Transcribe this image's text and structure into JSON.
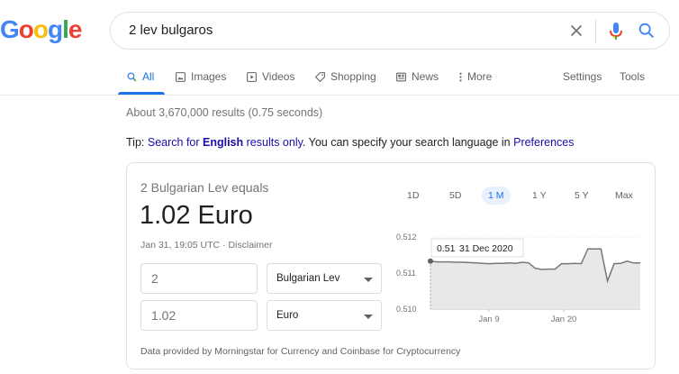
{
  "logo": {
    "letters": [
      "G",
      "o",
      "o",
      "g",
      "l",
      "e"
    ],
    "colors": [
      "#4285f4",
      "#ea4335",
      "#fbbc05",
      "#4285f4",
      "#34a853",
      "#ea4335"
    ]
  },
  "search": {
    "query": "2 lev bulgaros",
    "icons": [
      "close-icon",
      "microphone-icon",
      "search-icon"
    ]
  },
  "tabs": [
    {
      "label": "All",
      "icon": "search-icon",
      "active": true
    },
    {
      "label": "Images",
      "icon": "image-icon"
    },
    {
      "label": "Videos",
      "icon": "play-icon"
    },
    {
      "label": "Shopping",
      "icon": "tag-icon"
    },
    {
      "label": "News",
      "icon": "newspaper-icon"
    },
    {
      "label": "More",
      "icon": "more-vertical-icon"
    },
    {
      "label": "Settings"
    },
    {
      "label": "Tools"
    }
  ],
  "stats": "About 3,670,000 results (0.75 seconds)",
  "tip": {
    "prefix": "Tip: ",
    "link1": "Search for ",
    "bold": "English",
    "link2": " results only",
    "middle": ". You can specify your search language in ",
    "link3": "Preferences"
  },
  "converter": {
    "equals_label": "2 Bulgarian Lev equals",
    "result": "1.02 Euro",
    "meta": "Jan 31, 19:05 UTC · Disclaimer",
    "from_amount": "2",
    "from_currency": "Bulgarian Lev",
    "to_amount": "1.02",
    "to_currency": "Euro",
    "ranges": [
      "1D",
      "5D",
      "1 M",
      "1 Y",
      "5 Y",
      "Max"
    ],
    "active_range": "1 M",
    "footer": "Data provided by Morningstar for Currency and Coinbase for Cryptocurrency"
  },
  "chart_data": {
    "type": "area",
    "y_ticks": [
      "0.512",
      "0.511",
      "0.510"
    ],
    "ylim": [
      0.51,
      0.512
    ],
    "x_ticks": [
      "Jan 9",
      "Jan 20"
    ],
    "tooltip": {
      "value": "0.51",
      "date": "31 Dec 2020"
    },
    "line_color": "#777777",
    "fill_color": "#e8e8e8",
    "values": [
      0.51133,
      0.51131,
      0.51131,
      0.51131,
      0.5113,
      0.5113,
      0.51129,
      0.51128,
      0.51127,
      0.51126,
      0.51127,
      0.51127,
      0.51128,
      0.51127,
      0.5113,
      0.51128,
      0.51113,
      0.5111,
      0.51111,
      0.51111,
      0.51126,
      0.51126,
      0.51127,
      0.51126,
      0.51167,
      0.51167,
      0.51167,
      0.51078,
      0.51126,
      0.51127,
      0.51133,
      0.51128,
      0.51128
    ]
  }
}
